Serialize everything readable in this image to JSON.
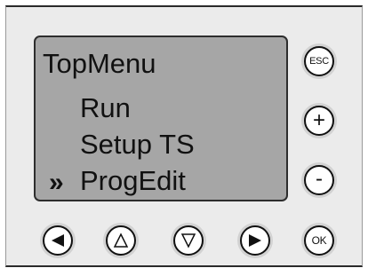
{
  "display": {
    "title": "TopMenu",
    "items": [
      "Run",
      "Setup TS",
      "ProgEdit"
    ],
    "cursor": "»",
    "selected_index": 2
  },
  "side_buttons": {
    "esc_label": "ESC",
    "plus_label": "+",
    "minus_label": "-"
  },
  "bottom_buttons": {
    "ok_label": "OK"
  },
  "colors": {
    "panel": "#ebebeb",
    "lcd": "#a6a6a6",
    "button_face": "#ffffff",
    "ink": "#111111"
  },
  "icons": [
    "left-arrow-icon",
    "up-arrow-icon",
    "down-arrow-icon",
    "right-arrow-icon"
  ]
}
